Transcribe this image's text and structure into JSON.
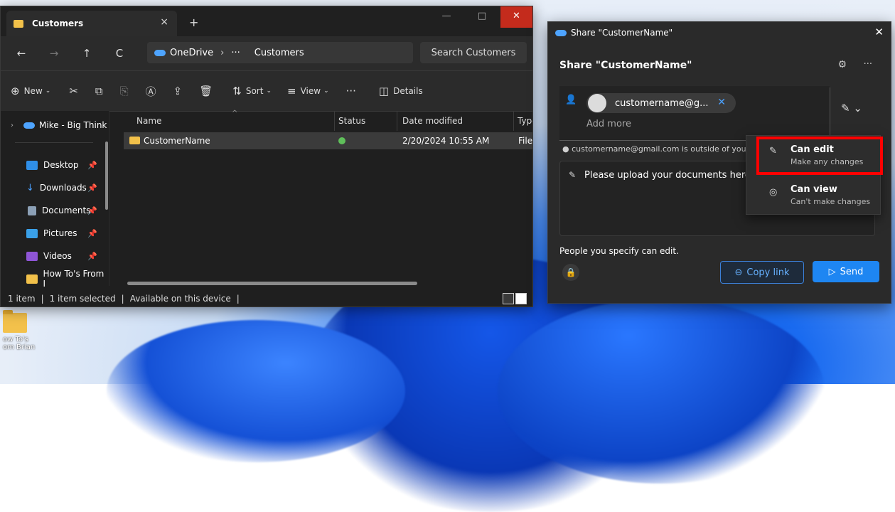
{
  "desktop": {
    "icon_label": "ow To's\nom Brian"
  },
  "explorer": {
    "tab_title": "Customers",
    "tab_close": "×",
    "new_tab": "+",
    "window_controls": {
      "minimize": "—",
      "maximize": "□",
      "close": "✕"
    },
    "nav": {
      "back": "←",
      "forward": "→",
      "up": "↑",
      "refresh": "C"
    },
    "breadcrumb": {
      "root": "OneDrive",
      "ellipsis": "···",
      "current": "Customers",
      "sep": "›"
    },
    "search_placeholder": "Search Customers",
    "toolbar": {
      "new_label": "New",
      "sort_label": "Sort",
      "view_label": "View",
      "more_label": "···",
      "details_label": "Details"
    },
    "nav_pane": {
      "top_item": "Mike - Big Think",
      "items": [
        {
          "label": "Desktop"
        },
        {
          "label": "Downloads"
        },
        {
          "label": "Documents"
        },
        {
          "label": "Pictures"
        },
        {
          "label": "Videos"
        },
        {
          "label": "How To's From I"
        }
      ]
    },
    "columns": [
      "Name",
      "Status",
      "Date modified",
      "Type"
    ],
    "rows": [
      {
        "name": "CustomerName",
        "date": "2/20/2024 10:55 AM",
        "type": "File"
      }
    ],
    "status_bar": {
      "count": "1 item",
      "selected": "1 item selected",
      "availability": "Available on this device"
    }
  },
  "share": {
    "window_title": "Share \"CustomerName\"",
    "heading": "Share \"CustomerName\"",
    "recipient_email": "customername@g...",
    "add_more_placeholder": "Add more",
    "outside_warning": "customername@gmail.com is outside of your",
    "message": "Please upload your documents here",
    "permission_note": "People you specify can edit.",
    "copy_link_label": "Copy link",
    "send_label": "Send",
    "options": [
      {
        "title": "Can edit",
        "desc": "Make any changes"
      },
      {
        "title": "Can view",
        "desc": "Can't make changes"
      }
    ]
  },
  "colors": {
    "accent": "#1e86f2",
    "highlight": "#ff0000",
    "close_button": "#c42b1c"
  }
}
